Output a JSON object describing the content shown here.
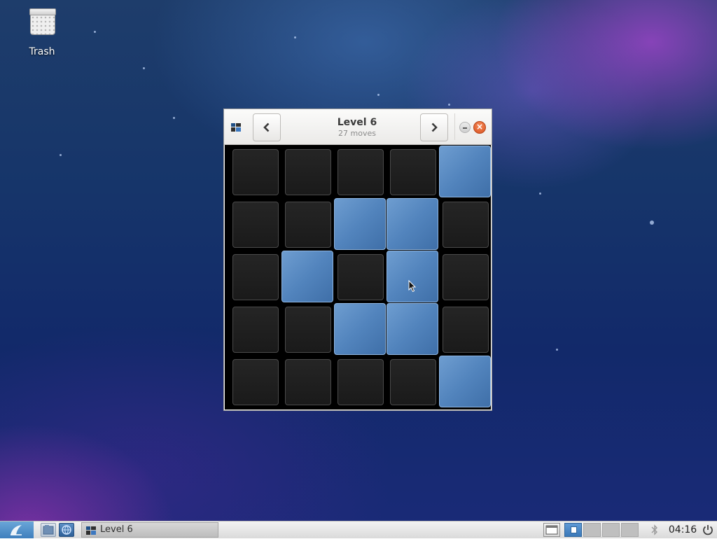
{
  "desktop": {
    "icons": [
      {
        "label": "Trash",
        "icon": "trash-icon"
      }
    ]
  },
  "window": {
    "title": "Level 6",
    "subtitle": "27 moves",
    "buttons": {
      "prev_icon": "chevron-left-icon",
      "next_icon": "chevron-right-icon",
      "minimize_icon": "minimize-icon",
      "close_icon": "close-icon"
    },
    "board": {
      "rows": 5,
      "cols": 5,
      "lit": [
        [
          false,
          false,
          false,
          false,
          true
        ],
        [
          false,
          false,
          true,
          true,
          false
        ],
        [
          false,
          true,
          false,
          true,
          false
        ],
        [
          false,
          false,
          true,
          true,
          false
        ],
        [
          false,
          false,
          false,
          false,
          true
        ]
      ]
    }
  },
  "taskbar": {
    "menu_icon": "start-menu-icon",
    "launchers": [
      "file-manager-icon",
      "browser-icon"
    ],
    "tasks": [
      {
        "label": "Level 6",
        "icon": "lights-off-game-icon"
      }
    ],
    "workspaces": 4,
    "active_workspace": 1,
    "tray": [
      "show-desktop-icon",
      "bluetooth-icon",
      "power-icon"
    ],
    "clock": "04:16"
  },
  "colors": {
    "tile_on": "#5284bd",
    "tile_off": "#1f1f1f",
    "board_background": "#000000",
    "close_button": "#e0602a"
  }
}
